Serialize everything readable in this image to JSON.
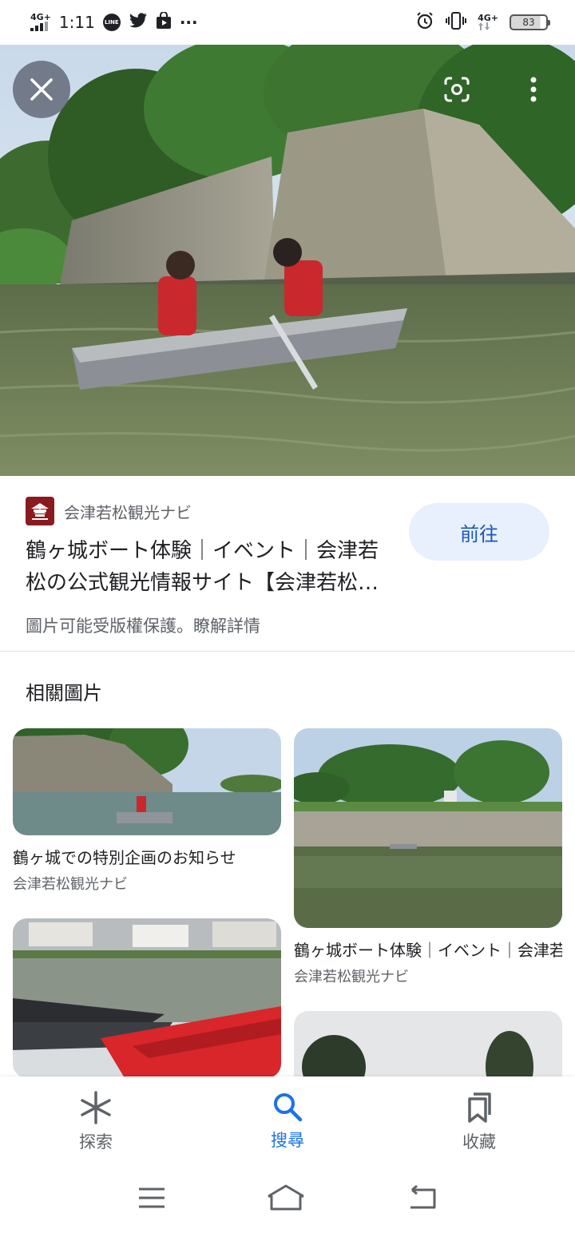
{
  "status_bar": {
    "network_left": "4G+",
    "time": "1:11",
    "line_badge": "LINE",
    "more": "···",
    "network_right": "4G+",
    "battery": "83"
  },
  "hero": {
    "close_icon": "close-icon",
    "lens_icon": "google-lens-icon",
    "more_icon": "more-vert-icon"
  },
  "result": {
    "source": "会津若松観光ナビ",
    "title": "鶴ヶ城ボート体験｜イベント｜会津若松の公式観光情報サイト【会津若松観光ナビ】",
    "visit_label": "前往",
    "copyright": "圖片可能受版權保護。瞭解詳情"
  },
  "related": {
    "heading": "相關圖片",
    "items": [
      {
        "title": "鶴ヶ城での特別企画のお知らせ",
        "source": "会津若松観光ナビ"
      },
      {
        "title": "鶴ヶ城ボート体験｜イベント｜会津若松の公式観光情報サイト",
        "source": "会津若松観光ナビ"
      },
      {
        "title": "",
        "source": ""
      },
      {
        "title": "",
        "source": ""
      }
    ]
  },
  "bottom_nav": {
    "items": [
      {
        "label": "探索",
        "icon": "asterisk-icon",
        "active": false
      },
      {
        "label": "搜尋",
        "icon": "search-icon",
        "active": true
      },
      {
        "label": "收藏",
        "icon": "bookmarks-icon",
        "active": false
      }
    ]
  },
  "colors": {
    "accent": "#1a73e8",
    "visit_button_bg": "#e8f0fe",
    "muted_text": "#5f6368"
  }
}
